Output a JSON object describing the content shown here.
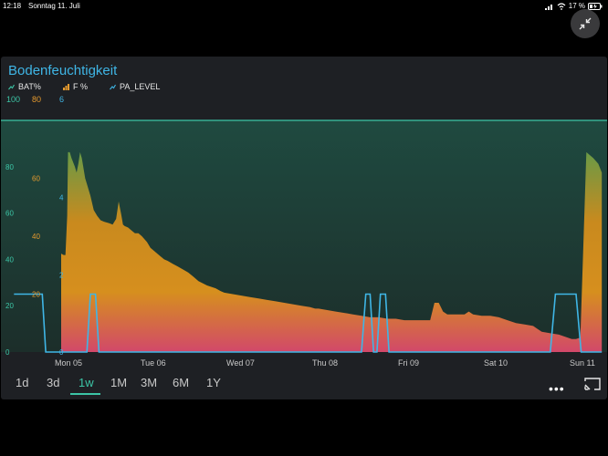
{
  "status_bar": {
    "time": "12:18",
    "date": "Sonntag 11. Juli",
    "battery_percent": "17 %",
    "icons": [
      "signal-icon",
      "wifi-icon",
      "battery-charging-icon"
    ]
  },
  "widget": {
    "title": "Bodenfeuchtigkeit",
    "legend": [
      {
        "label": "BAT%",
        "value": "100",
        "color": "#3cc5a6",
        "icon": "line-chart-icon"
      },
      {
        "label": "F %",
        "value": "80",
        "color": "#e59a2e",
        "icon": "bar-chart-icon"
      },
      {
        "label": "PA_LEVEL",
        "value": "6",
        "color": "#3fb6e6",
        "icon": "line-chart-icon"
      }
    ]
  },
  "chart_data": {
    "type": "area",
    "x": [
      "Mon 05",
      "Tue 06",
      "Wed 07",
      "Thu 08",
      "Fri 09",
      "Sat 10",
      "Sun 11"
    ],
    "axes": [
      {
        "name": "BAT%",
        "color": "#3cc5a6",
        "ticks": [
          "0",
          "20",
          "40",
          "60",
          "80"
        ],
        "range": [
          0,
          100
        ]
      },
      {
        "name": "F %",
        "color": "#e59a2e",
        "ticks": [
          "20",
          "40",
          "60"
        ],
        "range": [
          0,
          80
        ]
      },
      {
        "name": "PA_LEVEL",
        "color": "#3fb6e6",
        "ticks": [
          "0",
          "2",
          "4"
        ],
        "range": [
          0,
          6
        ]
      }
    ],
    "series": [
      {
        "name": "BAT%",
        "color": "#3cc5a6",
        "values": [
          100,
          100,
          100,
          100,
          100,
          100,
          100
        ]
      },
      {
        "name": "F %",
        "color": "#e59a2e",
        "points": [
          [
            0,
            34
          ],
          [
            0.03,
            33.5
          ],
          [
            0.05,
            33.5
          ],
          [
            0.07,
            47
          ],
          [
            0.08,
            69
          ],
          [
            0.1,
            69
          ],
          [
            0.12,
            67
          ],
          [
            0.16,
            64
          ],
          [
            0.18,
            62
          ],
          [
            0.2,
            65
          ],
          [
            0.22,
            69
          ],
          [
            0.24,
            67
          ],
          [
            0.28,
            60
          ],
          [
            0.3,
            58
          ],
          [
            0.34,
            54
          ],
          [
            0.38,
            49
          ],
          [
            0.42,
            47
          ],
          [
            0.46,
            45.5
          ],
          [
            0.5,
            45
          ],
          [
            0.56,
            44.5
          ],
          [
            0.6,
            44
          ],
          [
            0.64,
            46
          ],
          [
            0.67,
            52
          ],
          [
            0.7,
            47.5
          ],
          [
            0.72,
            44
          ],
          [
            0.74,
            43.5
          ],
          [
            0.78,
            43
          ],
          [
            0.82,
            42
          ],
          [
            0.86,
            41
          ],
          [
            0.9,
            41
          ],
          [
            0.94,
            40
          ],
          [
            1.0,
            38
          ],
          [
            1.04,
            36
          ],
          [
            1.08,
            35
          ],
          [
            1.12,
            34
          ],
          [
            1.16,
            33
          ],
          [
            1.2,
            32
          ],
          [
            1.24,
            31.5
          ],
          [
            1.3,
            30.5
          ],
          [
            1.36,
            29.5
          ],
          [
            1.42,
            28.5
          ],
          [
            1.48,
            27.5
          ],
          [
            1.54,
            26
          ],
          [
            1.6,
            24.5
          ],
          [
            1.7,
            23
          ],
          [
            1.8,
            22
          ],
          [
            1.86,
            21
          ],
          [
            1.9,
            20.5
          ],
          [
            2.0,
            20
          ],
          [
            2.1,
            19.5
          ],
          [
            2.2,
            19
          ],
          [
            2.3,
            18.5
          ],
          [
            2.4,
            18
          ],
          [
            2.5,
            17.5
          ],
          [
            2.6,
            17
          ],
          [
            2.7,
            16.5
          ],
          [
            2.8,
            16
          ],
          [
            2.9,
            15.5
          ],
          [
            2.96,
            15
          ],
          [
            3.0,
            15
          ],
          [
            3.1,
            14.5
          ],
          [
            3.2,
            14
          ],
          [
            3.3,
            13.5
          ],
          [
            3.4,
            13
          ],
          [
            3.5,
            12.5
          ],
          [
            3.6,
            12
          ],
          [
            3.7,
            12
          ],
          [
            3.8,
            11.5
          ],
          [
            3.9,
            11.5
          ],
          [
            4.0,
            11
          ],
          [
            4.1,
            11
          ],
          [
            4.2,
            11
          ],
          [
            4.3,
            11
          ],
          [
            4.35,
            17
          ],
          [
            4.4,
            17
          ],
          [
            4.45,
            14
          ],
          [
            4.5,
            13
          ],
          [
            4.6,
            13
          ],
          [
            4.7,
            13
          ],
          [
            4.75,
            14
          ],
          [
            4.8,
            13
          ],
          [
            4.9,
            12.5
          ],
          [
            5.0,
            12.5
          ],
          [
            5.1,
            12
          ],
          [
            5.15,
            11.5
          ],
          [
            5.2,
            11
          ],
          [
            5.3,
            10
          ],
          [
            5.4,
            9.5
          ],
          [
            5.5,
            9
          ],
          [
            5.55,
            8
          ],
          [
            5.6,
            7
          ],
          [
            5.7,
            6.5
          ],
          [
            5.8,
            6
          ],
          [
            5.9,
            5
          ],
          [
            5.95,
            4.5
          ],
          [
            6.0,
            4.5
          ],
          [
            6.05,
            5
          ],
          [
            6.08,
            32
          ],
          [
            6.12,
            69
          ],
          [
            6.2,
            67
          ],
          [
            6.26,
            65
          ],
          [
            6.3,
            62
          ]
        ]
      },
      {
        "name": "PA_LEVEL",
        "color": "#3fb6e6",
        "points": [
          [
            -0.55,
            1.5
          ],
          [
            -0.28,
            1.5
          ],
          [
            -0.22,
            1.5
          ],
          [
            -0.18,
            0
          ],
          [
            0.3,
            0
          ],
          [
            0.34,
            1.5
          ],
          [
            0.4,
            1.5
          ],
          [
            0.44,
            0
          ],
          [
            3.5,
            0
          ],
          [
            3.55,
            1.5
          ],
          [
            3.6,
            1.5
          ],
          [
            3.64,
            0
          ],
          [
            3.68,
            0
          ],
          [
            3.72,
            1.5
          ],
          [
            3.78,
            1.5
          ],
          [
            3.82,
            0
          ],
          [
            5.7,
            0
          ],
          [
            5.76,
            1.5
          ],
          [
            6.0,
            1.5
          ],
          [
            6.06,
            0
          ],
          [
            6.3,
            0
          ]
        ]
      }
    ]
  },
  "range_buttons": [
    "1d",
    "3d",
    "1w",
    "1M",
    "3M",
    "6M",
    "1Y"
  ],
  "active_range": "1w",
  "colors": {
    "background": "#000000",
    "widget_bg": "#1e2024",
    "bat_line": "#3cc5a6",
    "f_top": "#6a9a46",
    "f_mid": "#d68f1e",
    "f_bottom": "#d2486a",
    "pa_line": "#3fb6e6",
    "accent": "#3cc5a6",
    "title": "#3fb6e6"
  }
}
